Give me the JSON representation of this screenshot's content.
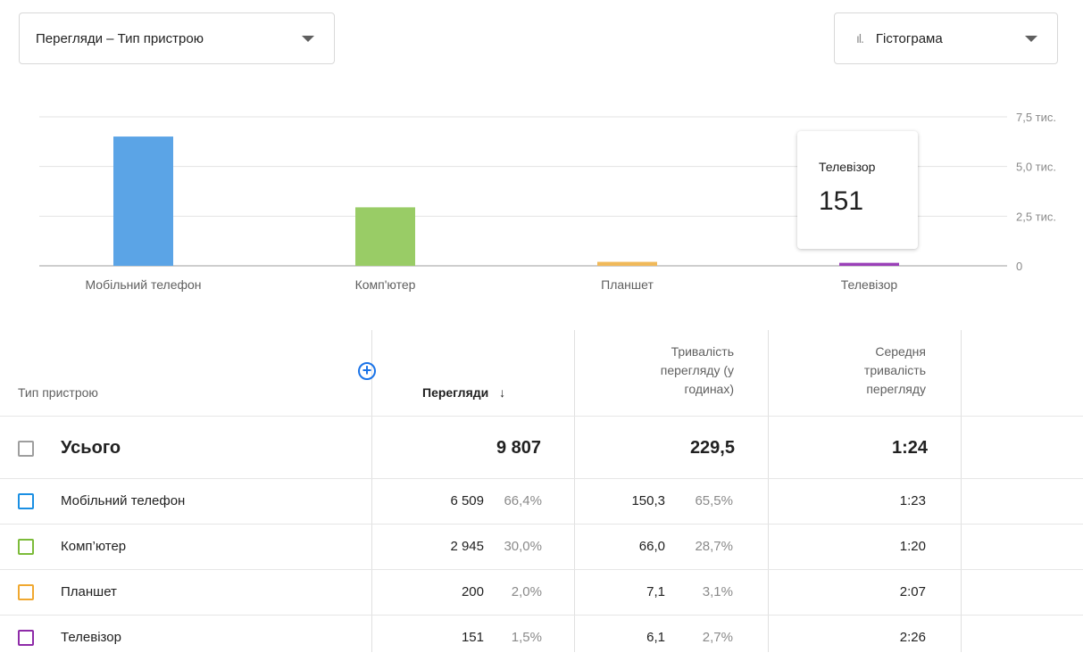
{
  "metric_dropdown": {
    "label": "Перегляди – Тип пристрою"
  },
  "chart_type_dropdown": {
    "icon": "bar-chart-icon",
    "label": "Гістограма"
  },
  "chart_data": {
    "type": "bar",
    "categories": [
      "Мобільний телефон",
      "Комп'ютер",
      "Планшет",
      "Телевізор"
    ],
    "values": [
      6509,
      2945,
      200,
      151
    ],
    "colors": [
      "#5ba4e6",
      "#99cc66",
      "#f0b95a",
      "#9a40b8"
    ],
    "ylim": [
      0,
      7500
    ],
    "yticks": [
      {
        "value": 0,
        "label": "0"
      },
      {
        "value": 2500,
        "label": "2,5 тис."
      },
      {
        "value": 5000,
        "label": "5,0 тис."
      },
      {
        "value": 7500,
        "label": "7,5 тис."
      }
    ],
    "grid": true
  },
  "tooltip": {
    "label": "Телевізор",
    "value": "151"
  },
  "table": {
    "headers": {
      "device": "Тип пристрою",
      "views": "Перегляди",
      "duration": [
        "Тривалість",
        "перегляду (у",
        "годинах)"
      ],
      "avg": [
        "Середня",
        "тривалість",
        "перегляду"
      ]
    },
    "total": {
      "label": "Усього",
      "views": "9 807",
      "duration": "229,5",
      "avg": "1:24"
    },
    "rows": [
      {
        "label": "Мобільний телефон",
        "color": "#1a8fe3",
        "views": "6 509",
        "views_pct": "66,4%",
        "duration": "150,3",
        "duration_pct": "65,5%",
        "avg": "1:23"
      },
      {
        "label": "Комп’ютер",
        "color": "#7cbb3a",
        "views": "2 945",
        "views_pct": "30,0%",
        "duration": "66,0",
        "duration_pct": "28,7%",
        "avg": "1:20"
      },
      {
        "label": "Планшет",
        "color": "#f0a830",
        "views": "200",
        "views_pct": "2,0%",
        "duration": "7,1",
        "duration_pct": "3,1%",
        "avg": "2:07"
      },
      {
        "label": "Телевізор",
        "color": "#8e2ba8",
        "views": "151",
        "views_pct": "1,5%",
        "duration": "6,1",
        "duration_pct": "2,7%",
        "avg": "2:26"
      }
    ]
  }
}
